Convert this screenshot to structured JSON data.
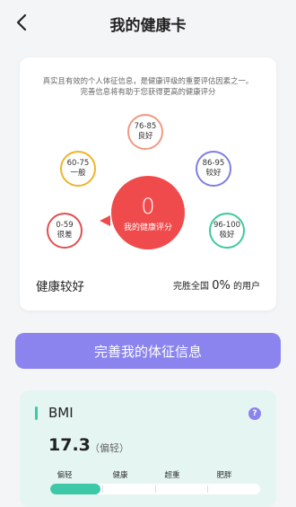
{
  "header": {
    "title": "我的健康卡"
  },
  "card": {
    "desc_line1": "真实且有效的个人体征信息，是健康评级的重要评估因素之一。",
    "desc_line2": "完善信息将有助于您获得更高的健康评分",
    "score": "0",
    "score_label": "我的健康评分",
    "status": "健康较好",
    "rank_prefix": "完胜全国",
    "rank_value": "0%",
    "rank_suffix": "的用户",
    "levels": [
      {
        "range": "0-59",
        "label": "很差",
        "color": "#e05050"
      },
      {
        "range": "60-75",
        "label": "一般",
        "color": "#f0b429"
      },
      {
        "range": "76-85",
        "label": "良好",
        "color": "#f09a82"
      },
      {
        "range": "86-95",
        "label": "较好",
        "color": "#7f7fe0"
      },
      {
        "range": "96-100",
        "label": "极好",
        "color": "#3ccb98"
      }
    ]
  },
  "cta": {
    "label": "完善我的体征信息"
  },
  "bmi": {
    "title": "BMI",
    "help": "?",
    "value": "17.3",
    "category": "（偏轻）",
    "scale_labels": [
      "偏轻",
      "健康",
      "超重",
      "肥胖"
    ],
    "fill_fraction": 0.24,
    "accent": "#3dc9a8"
  }
}
